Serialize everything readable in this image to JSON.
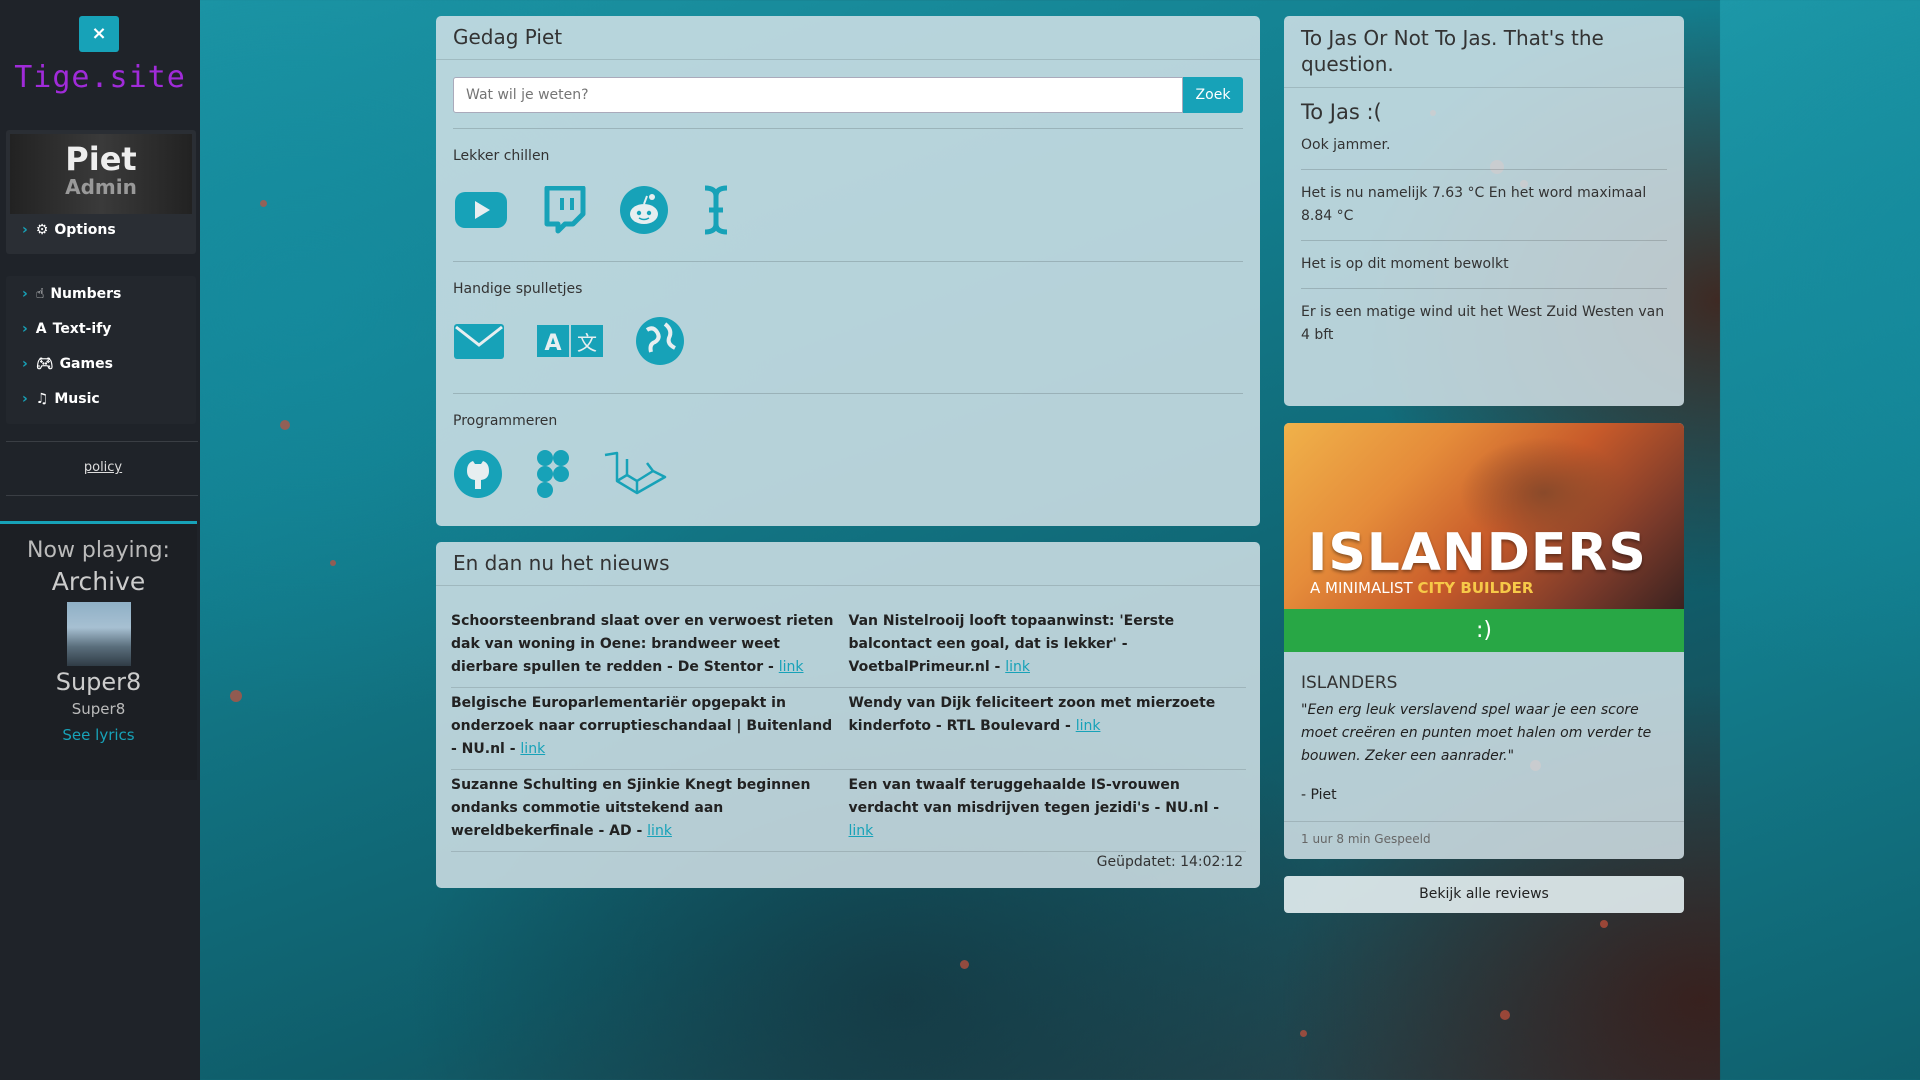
{
  "sidebar": {
    "close_label": "×",
    "brand": "Tige.site",
    "user": {
      "name": "Piet",
      "role": "Admin"
    },
    "options_label": "Options",
    "nav": [
      {
        "label": "Numbers",
        "icon": "hand-pointer-icon"
      },
      {
        "label": "Text-ify",
        "icon": "font-icon"
      },
      {
        "label": "Games",
        "icon": "gamepad-icon"
      },
      {
        "label": "Music",
        "icon": "music-icon"
      }
    ],
    "policy": "policy",
    "now_playing": {
      "label": "Now playing:",
      "album": "Archive",
      "artist": "Super8",
      "subtitle": "Super8",
      "lyrics_link": "See lyrics"
    }
  },
  "main": {
    "greeting": "Gedag Piet",
    "search": {
      "placeholder": "Wat wil je weten?",
      "button": "Zoek"
    },
    "sections": [
      {
        "label": "Lekker chillen",
        "icons": [
          "youtube-icon",
          "twitch-icon",
          "reddit-icon",
          "cursor-icon"
        ]
      },
      {
        "label": "Handige spulletjes",
        "icons": [
          "mail-icon",
          "translate-icon",
          "globe-icon"
        ]
      },
      {
        "label": "Programmeren",
        "icons": [
          "github-icon",
          "figma-icon",
          "laravel-icon"
        ]
      }
    ]
  },
  "news": {
    "title": "En dan nu het nieuws",
    "link_label": "link",
    "items": [
      {
        "text": "Schoorsteenbrand slaat over en verwoest rieten dak van woning in Oene: brandweer weet dierbare spullen te redden - De Stentor"
      },
      {
        "text": "Van Nistelrooij looft topaanwinst: 'Eerste balcontact een goal, dat is lekker' - VoetbalPrimeur.nl"
      },
      {
        "text": "Belgische Europarlementariër opgepakt in onderzoek naar corruptieschandaal | Buitenland - NU.nl"
      },
      {
        "text": "Wendy van Dijk feliciteert zoon met mierzoete kinderfoto - RTL Boulevard"
      },
      {
        "text": "Suzanne Schulting en Sjinkie Knegt beginnen ondanks commotie uitstekend aan wereldbekerfinale - AD"
      },
      {
        "text": "Een van twaalf teruggehaalde IS-vrouwen verdacht van misdrijven tegen jezidi's - NU.nl"
      }
    ],
    "updated": "Geüpdatet: 14:02:12"
  },
  "weather": {
    "title": "To Jas Or Not To Jas. That's the question.",
    "verdict": "To Jas :(",
    "lines": [
      "Ook jammer.",
      "Het is nu namelijk 7.63 °C En het word maximaal 8.84 °C",
      "Het is op dit moment bewolkt",
      "Er is een matige wind uit het West Zuid Westen van 4 bft"
    ]
  },
  "game": {
    "art_title": "ISLANDERS",
    "art_subtitle_a": "A MINIMALIST ",
    "art_subtitle_b": "CITY BUILDER",
    "mood": ":)",
    "name": "ISLANDERS",
    "review": "\"Een erg leuk verslavend spel waar je een score moet creëren en punten moet halen om verder te bouwen. Zeker een aanrader.\"",
    "author": "- Piet",
    "played": "1 uur 8 min Gespeeld",
    "all_reviews": "Bekijk alle reviews"
  },
  "colors": {
    "accent": "#17a2b8",
    "brand": "#a02bd9",
    "mood_good": "#28a745"
  }
}
